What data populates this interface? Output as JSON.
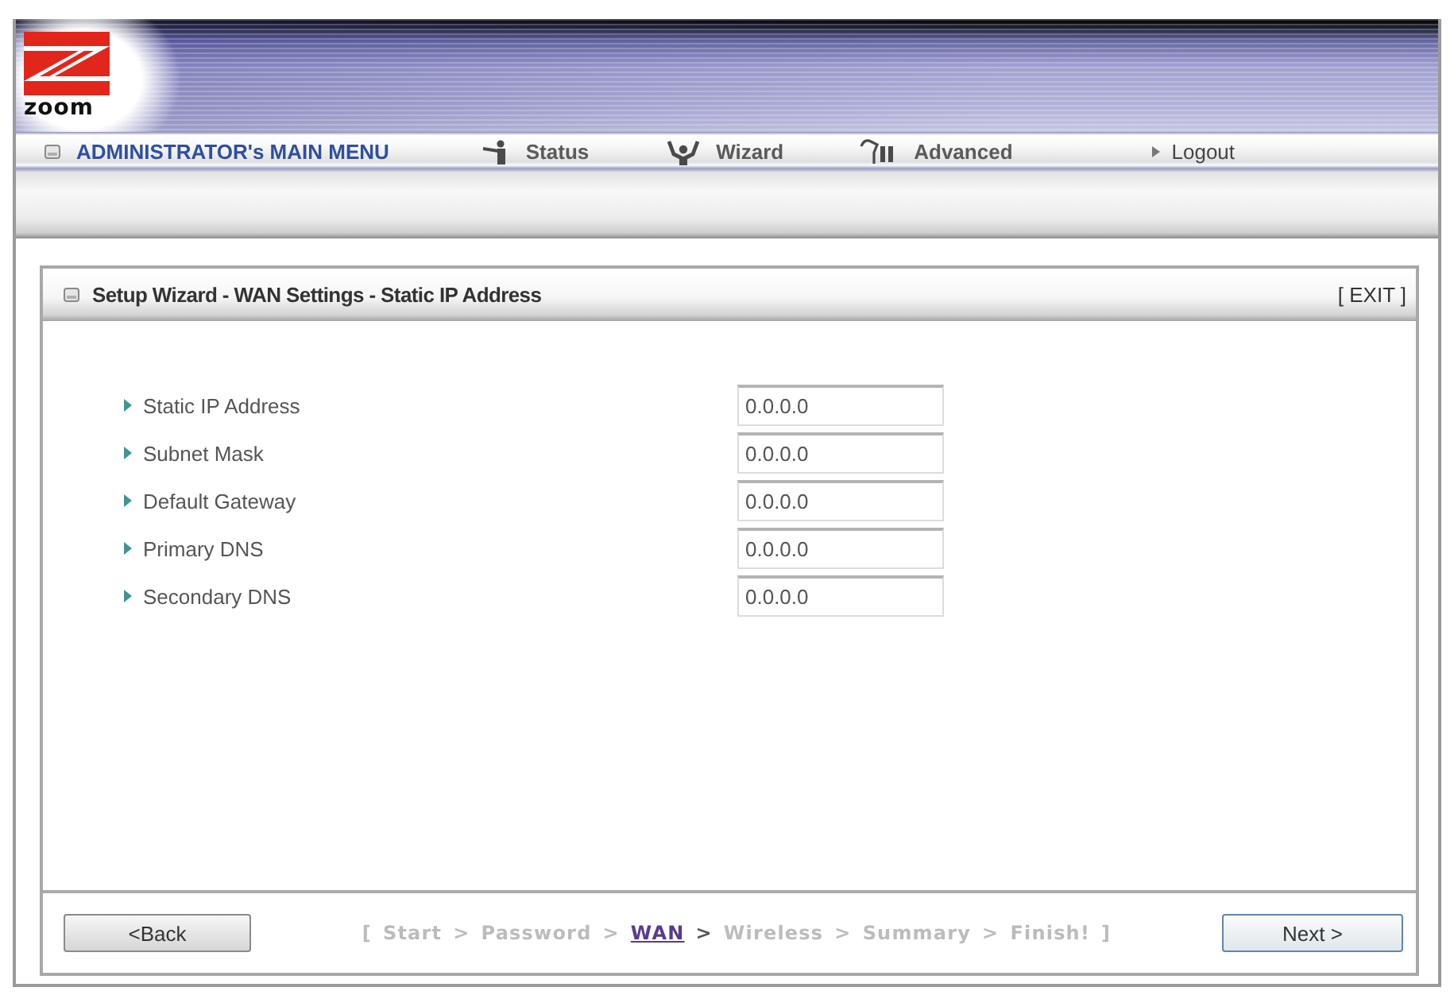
{
  "banner": {
    "logo_text": "zoom"
  },
  "menu": {
    "title": "ADMINISTRATOR's MAIN MENU",
    "items": [
      {
        "label": "Status",
        "kind": "status"
      },
      {
        "label": "Wizard",
        "kind": "wizard"
      },
      {
        "label": "Advanced",
        "kind": "advanced"
      },
      {
        "label": "Logout",
        "kind": "logout"
      }
    ]
  },
  "panel": {
    "title": "Setup Wizard - WAN Settings - Static IP Address",
    "exit": "[ EXIT ]",
    "fields": [
      {
        "label": "Static IP Address",
        "value": "0.0.0.0"
      },
      {
        "label": "Subnet Mask",
        "value": "0.0.0.0"
      },
      {
        "label": "Default Gateway",
        "value": "0.0.0.0"
      },
      {
        "label": "Primary DNS",
        "value": "0.0.0.0"
      },
      {
        "label": "Secondary DNS",
        "value": "0.0.0.0"
      }
    ],
    "footer": {
      "buttons": [
        {
          "label": "<Back",
          "default": false
        },
        {
          "label": "Next >",
          "default": true
        }
      ],
      "steps": {
        "open": "[",
        "close": "]",
        "separator": ">",
        "items": [
          {
            "label": "Start",
            "selected": false
          },
          {
            "label": "Password",
            "selected": false
          },
          {
            "label": "WAN",
            "selected": true
          },
          {
            "label": "Wireless",
            "selected": false
          },
          {
            "label": "Summary",
            "selected": false
          },
          {
            "label": "Finish!",
            "selected": false
          }
        ]
      }
    }
  }
}
